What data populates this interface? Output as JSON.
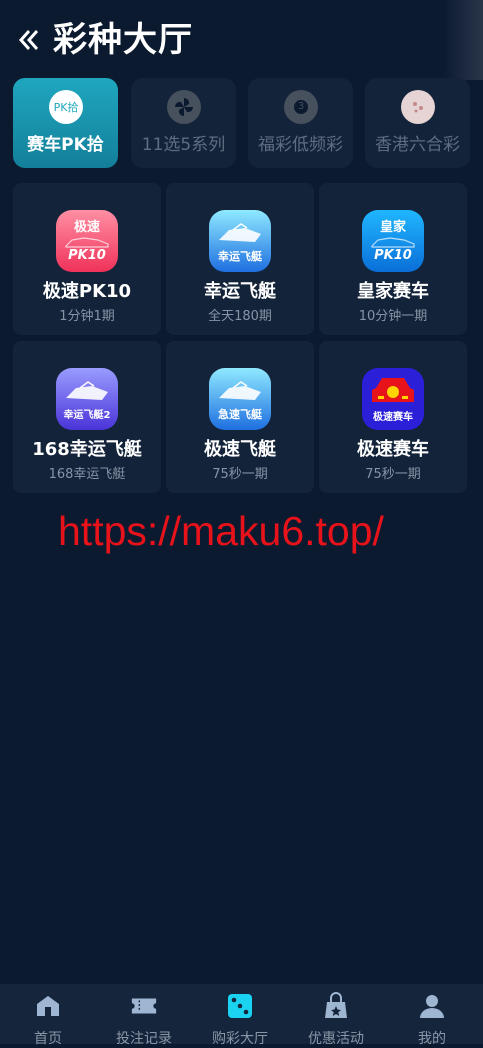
{
  "header": {
    "title": "彩种大厅",
    "back_icon": "chevron-left-icon"
  },
  "tabs": [
    {
      "label": "赛车PK拾",
      "icon": "pk-icon",
      "icon_text": "PK拾",
      "active": true
    },
    {
      "label": "11选5系列",
      "icon": "pinwheel-icon",
      "icon_text": "",
      "active": false
    },
    {
      "label": "福彩低频彩",
      "icon": "lottery-ball-icon",
      "icon_text": "3",
      "active": false
    },
    {
      "label": "香港六合彩",
      "icon": "mark-six-icon",
      "icon_text": "",
      "active": false
    }
  ],
  "games": [
    {
      "name": "极速PK10",
      "sub": "1分钟1期",
      "icon": "race-car-pk10-icon",
      "icon_top": "极速",
      "icon_bottom": "PK10"
    },
    {
      "name": "幸运飞艇",
      "sub": "全天180期",
      "icon": "speedboat-icon",
      "icon_bottom": "幸运飞艇"
    },
    {
      "name": "皇家赛车",
      "sub": "10分钟一期",
      "icon": "race-car-pk10-icon",
      "icon_top": "皇家",
      "icon_bottom": "PK10"
    },
    {
      "name": "168幸运飞艇",
      "sub": "168幸运飞艇",
      "icon": "speedboat-icon",
      "icon_bottom": "幸运飞艇2"
    },
    {
      "name": "极速飞艇",
      "sub": "75秒一期",
      "icon": "speedboat-icon",
      "icon_bottom": "急速飞艇"
    },
    {
      "name": "极速赛车",
      "sub": "75秒一期",
      "icon": "red-car-icon",
      "icon_bottom": "极速赛车"
    }
  ],
  "watermark": "https://maku6.top/",
  "nav": [
    {
      "label": "首页",
      "icon": "home-icon"
    },
    {
      "label": "投注记录",
      "icon": "ticket-icon"
    },
    {
      "label": "购彩大厅",
      "icon": "dice-icon"
    },
    {
      "label": "优惠活动",
      "icon": "gift-bag-icon"
    },
    {
      "label": "我的",
      "icon": "user-icon"
    }
  ],
  "colors": {
    "background": "#0c1a30",
    "card": "#132339",
    "active_tab": "#1fa7bf",
    "watermark": "#e8121a",
    "nav_bg": "#15253b",
    "dice_accent": "#19d3f0"
  }
}
